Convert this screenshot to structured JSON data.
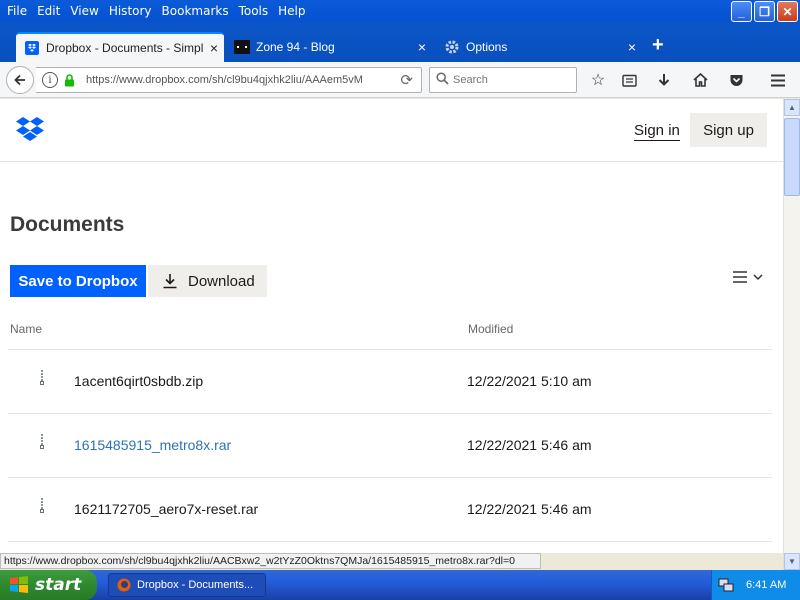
{
  "menu": [
    "File",
    "Edit",
    "View",
    "History",
    "Bookmarks",
    "Tools",
    "Help"
  ],
  "tabs": [
    {
      "label": "Dropbox - Documents - Simpli...",
      "icon": "dropbox-icon",
      "active": true
    },
    {
      "label": "Zone 94 - Blog",
      "icon": "zone94-icon",
      "active": false
    },
    {
      "label": "Options",
      "icon": "gear-icon",
      "active": false
    }
  ],
  "nav": {
    "url": "https://www.dropbox.com/sh/cl9bu4qjxhk2liu/AAAem5vM",
    "search_placeholder": "Search"
  },
  "header": {
    "signin": "Sign in",
    "signup": "Sign up"
  },
  "page": {
    "title": "Documents",
    "save_button": "Save to Dropbox",
    "download_button": "Download",
    "col_name": "Name",
    "col_modified": "Modified"
  },
  "files": [
    {
      "name": "1acent6qirt0sbdb.zip",
      "modified": "12/22/2021 5:10 am",
      "hovered": false
    },
    {
      "name": "1615485915_metro8x.rar",
      "modified": "12/22/2021 5:46 am",
      "hovered": true
    },
    {
      "name": "1621172705_aero7x-reset.rar",
      "modified": "12/22/2021 5:46 am",
      "hovered": false
    }
  ],
  "status_url": "https://www.dropbox.com/sh/cl9bu4qjxhk2liu/AACBxw2_w2tYzZ0Oktns7QMJa/1615485915_metro8x.rar?dl=0",
  "taskbar": {
    "start": "start",
    "task": "Dropbox - Documents...",
    "clock": "6:41 AM"
  },
  "colors": {
    "dropbox_blue": "#0061FE",
    "link": "#2E72B8",
    "xp_blue": "#245DDA"
  }
}
